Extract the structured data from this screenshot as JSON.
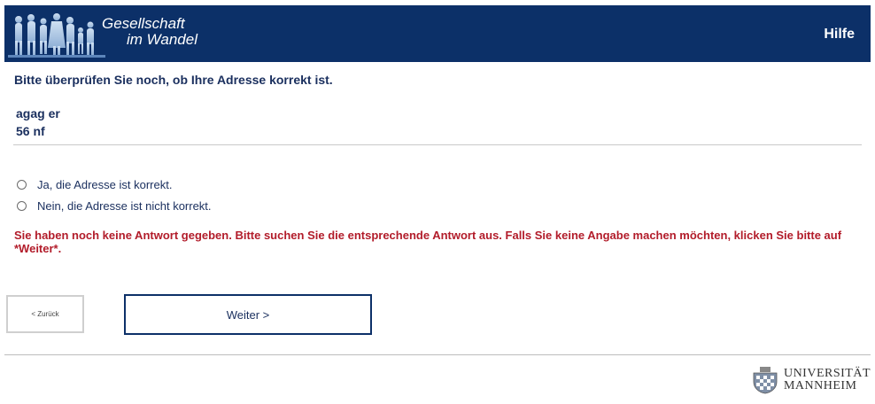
{
  "header": {
    "logo_line1": "Gesellschaft",
    "logo_line2": "im Wandel",
    "help_label": "Hilfe"
  },
  "question": "Bitte überprüfen Sie noch, ob Ihre Adresse korrekt ist.",
  "address": {
    "line1": "agag er",
    "line2": "56 nf"
  },
  "options": [
    {
      "label": "Ja, die Adresse ist korrekt."
    },
    {
      "label": "Nein, die Adresse ist nicht korrekt."
    }
  ],
  "error_message": "Sie haben noch keine Antwort gegeben. Bitte suchen Sie die entsprechende Antwort aus. Falls Sie keine Angabe machen möchten, klicken Sie bitte auf *Weiter*.",
  "nav": {
    "back_label": "< Zurück",
    "next_label": "Weiter >"
  },
  "footer": {
    "uni_line1": "UNIVERSITÄT",
    "uni_line2": "MANNHEIM",
    "uni_logo_icon": "crest-icon"
  },
  "colors": {
    "header_bg": "#0c3068",
    "text": "#1a2f5e",
    "error": "#b21c2a"
  }
}
